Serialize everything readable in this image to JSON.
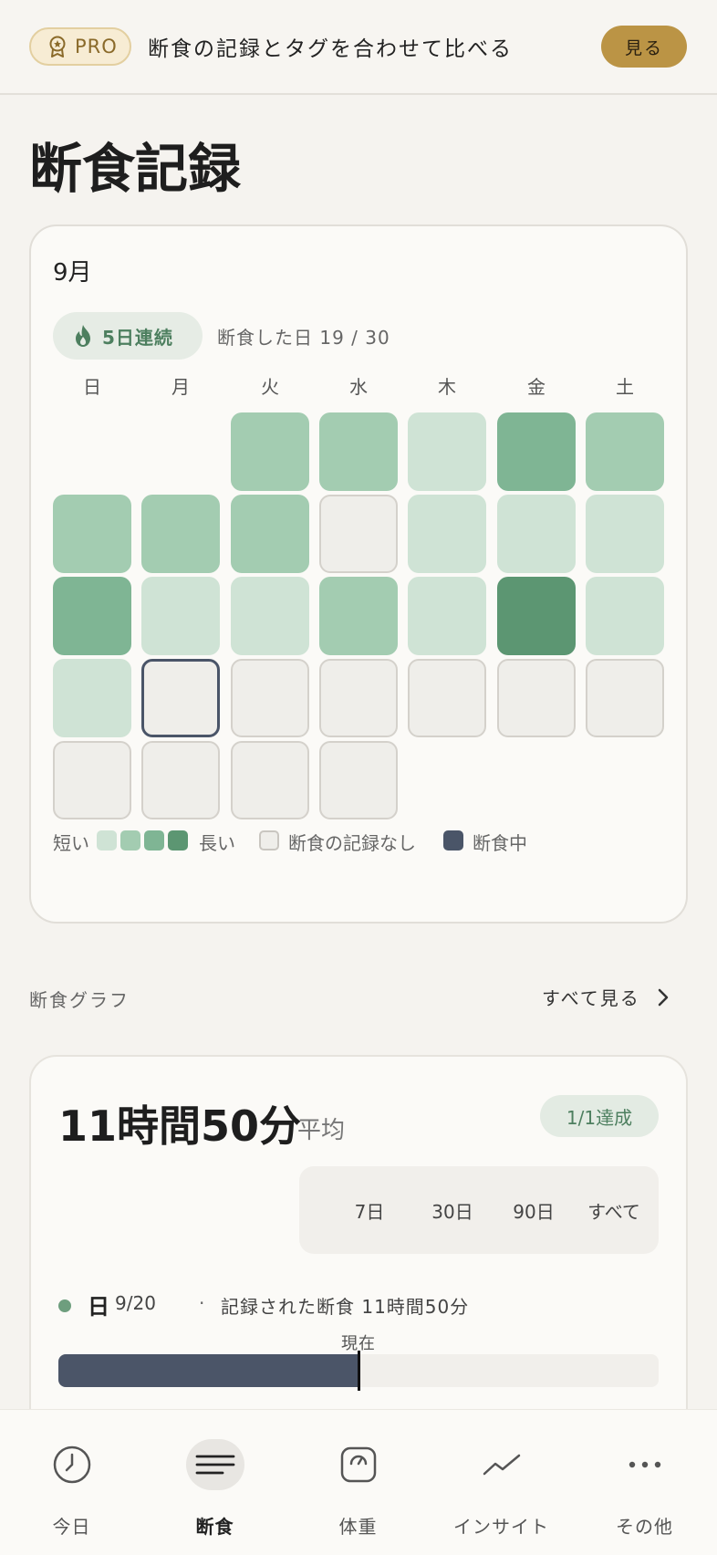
{
  "pro_banner": {
    "badge": "PRO",
    "message": "断食の記録とタグを合わせて比べる",
    "button": "見る"
  },
  "page_title": "断食記録",
  "calendar": {
    "month": "9月",
    "streak": "5日連続",
    "fasted_days": "断食した日 19 / 30",
    "weekdays": [
      "日",
      "月",
      "火",
      "水",
      "木",
      "金",
      "土"
    ],
    "first_weekday_index": 2,
    "today_date": 21,
    "day_levels": [
      2,
      2,
      1,
      3,
      2,
      2,
      2,
      2,
      0,
      1,
      1,
      1,
      3,
      1,
      1,
      2,
      1,
      4,
      1,
      1,
      0,
      0,
      0,
      0,
      0,
      0,
      0,
      0,
      0,
      0
    ],
    "legend": {
      "short": "短い",
      "long": "長い",
      "no_record": "断食の記録なし",
      "active": "断食中"
    },
    "colors": {
      "level_1": "#cfe3d5",
      "level_2": "#a3ccb1",
      "level_3": "#7fb594",
      "level_4": "#5c9672",
      "active": "#4a5568"
    }
  },
  "graph_section": {
    "title": "断食グラフ",
    "see_all": "すべて見る"
  },
  "graph_card": {
    "average_value": "11時間50分",
    "average_label": "平均",
    "achieved": "1/1達成",
    "range_tabs": [
      "7日",
      "30日",
      "90日",
      "すべて"
    ],
    "active_range": 0,
    "session": {
      "day": "日",
      "date": "9/20",
      "separator": "·",
      "description": "記録された断食 11時間50分"
    },
    "now_label": "現在",
    "progress_fraction": 0.5
  },
  "bottom_nav": {
    "items": [
      {
        "label": "今日",
        "icon": "clock-icon"
      },
      {
        "label": "断食",
        "icon": "menu-lines-icon"
      },
      {
        "label": "体重",
        "icon": "scale-icon"
      },
      {
        "label": "インサイト",
        "icon": "trend-line-icon"
      },
      {
        "label": "その他",
        "icon": "more-dots-icon"
      }
    ],
    "active_index": 1
  }
}
